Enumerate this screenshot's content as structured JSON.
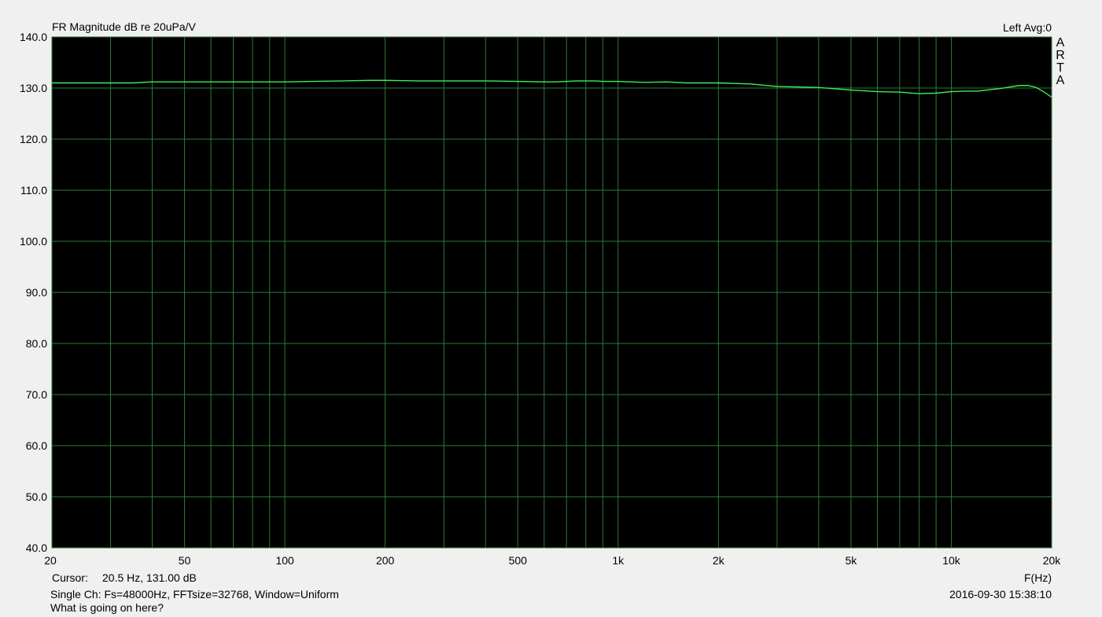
{
  "header": {
    "title": "FR Magnitude dB re 20uPa/V",
    "channel_info": "Left  Avg:0"
  },
  "watermark": [
    "A",
    "R",
    "T",
    "A"
  ],
  "footer": {
    "cursor_label": "Cursor:",
    "cursor_value": "20.5 Hz, 131.00 dB",
    "freq_axis_label": "F(Hz)",
    "settings": "Single Ch: Fs=48000Hz, FFTsize=32768, Window=Uniform",
    "timestamp": "2016-09-30  15:38:10",
    "comment": "What is going on here?"
  },
  "colors": {
    "plot_background": "#000000",
    "grid": "#2f7a3a",
    "trace": "#3cf050",
    "window_background": "#f0f0f0"
  },
  "chart_data": {
    "type": "line",
    "title": "FR Magnitude dB re 20uPa/V",
    "xlabel": "F(Hz)",
    "ylabel": "",
    "x_scale": "log",
    "xlim": [
      20,
      20000
    ],
    "ylim": [
      40,
      140
    ],
    "grid": true,
    "x_tick_labels": [
      {
        "value": 20,
        "label": "20"
      },
      {
        "value": 50,
        "label": "50"
      },
      {
        "value": 100,
        "label": "100"
      },
      {
        "value": 200,
        "label": "200"
      },
      {
        "value": 500,
        "label": "500"
      },
      {
        "value": 1000,
        "label": "1k"
      },
      {
        "value": 2000,
        "label": "2k"
      },
      {
        "value": 5000,
        "label": "5k"
      },
      {
        "value": 10000,
        "label": "10k"
      },
      {
        "value": 20000,
        "label": "20k"
      }
    ],
    "x_minor_gridlines": [
      30,
      40,
      60,
      70,
      80,
      90,
      300,
      400,
      600,
      700,
      800,
      900,
      3000,
      4000,
      6000,
      7000,
      8000,
      9000
    ],
    "y_ticks": [
      {
        "value": 40,
        "label": "40.0"
      },
      {
        "value": 50,
        "label": "50.0"
      },
      {
        "value": 60,
        "label": "60.0"
      },
      {
        "value": 70,
        "label": "70.0"
      },
      {
        "value": 80,
        "label": "80.0"
      },
      {
        "value": 90,
        "label": "90.0"
      },
      {
        "value": 100,
        "label": "100.0"
      },
      {
        "value": 110,
        "label": "110.0"
      },
      {
        "value": 120,
        "label": "120.0"
      },
      {
        "value": 130,
        "label": "130.0"
      },
      {
        "value": 140,
        "label": "140.0"
      }
    ],
    "series": [
      {
        "x": [
          20,
          25,
          30,
          35,
          40,
          50,
          60,
          80,
          100,
          120,
          150,
          180,
          200,
          250,
          300,
          400,
          500,
          600,
          650,
          700,
          750,
          800,
          850,
          900,
          1000,
          1200,
          1400,
          1600,
          1800,
          2000,
          2500,
          3000,
          3500,
          4000,
          5000,
          6000,
          7000,
          8000,
          9000,
          10000,
          11000,
          12000,
          14000,
          16000,
          17000,
          18000,
          19000,
          20000
        ],
        "y": [
          131.0,
          131.0,
          131.0,
          131.0,
          131.2,
          131.2,
          131.2,
          131.2,
          131.2,
          131.3,
          131.4,
          131.5,
          131.5,
          131.4,
          131.4,
          131.4,
          131.3,
          131.2,
          131.2,
          131.3,
          131.4,
          131.4,
          131.4,
          131.3,
          131.3,
          131.1,
          131.2,
          131.0,
          131.0,
          131.0,
          130.8,
          130.3,
          130.2,
          130.1,
          129.6,
          129.3,
          129.2,
          128.9,
          129.0,
          129.3,
          129.4,
          129.4,
          129.9,
          130.5,
          130.5,
          130.1,
          129.2,
          128.2
        ]
      }
    ]
  }
}
